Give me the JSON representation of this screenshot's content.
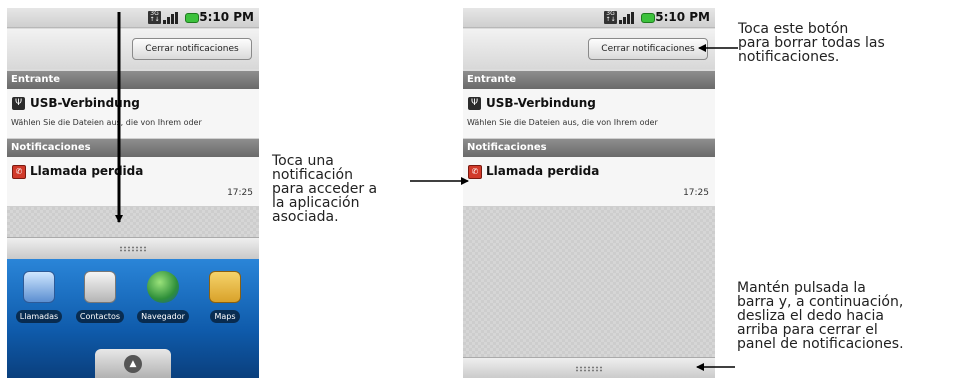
{
  "left_screen": {
    "status_bar": {
      "time": "5:10 PM",
      "network_icon": "3g-icon",
      "signal_icon": "signal-icon",
      "battery_icon": "battery-icon"
    },
    "clear_button": "Cerrar notificaciones",
    "sections": {
      "incoming": "Entrante",
      "notifications": "Notificaciones"
    },
    "usb_notification": {
      "icon": "usb-icon",
      "title": "USB-Verbindung",
      "text": "Wählen Sie die Dateien aus, die von Ihrem oder"
    },
    "call_notification": {
      "icon": "missed-call-icon",
      "title": "Llamada perdida",
      "time": "17:25"
    },
    "apps": [
      {
        "label": "Llamadas",
        "icon": "phone-icon"
      },
      {
        "label": "Contactos",
        "icon": "contacts-icon"
      },
      {
        "label": "Navegador",
        "icon": "globe-icon"
      },
      {
        "label": "Maps",
        "icon": "maps-icon"
      }
    ]
  },
  "right_screen": {
    "status_bar": {
      "time": "5:10 PM"
    },
    "clear_button": "Cerrar notificaciones",
    "sections": {
      "incoming": "Entrante",
      "notifications": "Notificaciones"
    },
    "usb_notification": {
      "title": "USB-Verbindung",
      "text": "Wählen Sie die Dateien aus, die von Ihrem oder"
    },
    "call_notification": {
      "title": "Llamada perdida",
      "time": "17:25"
    }
  },
  "annotations": {
    "tap_notification": [
      "Toca una",
      "notificación",
      "para acceder a",
      "la aplicación",
      "asociada."
    ],
    "clear_button": [
      "Toca este botón",
      "para borrar todas las",
      "notificaciones."
    ],
    "hold_bar": [
      "Mantén pulsada la",
      "barra y, a continuación,",
      "desliza el dedo hacia",
      "arriba para cerrar el",
      "panel de notificaciones."
    ]
  }
}
